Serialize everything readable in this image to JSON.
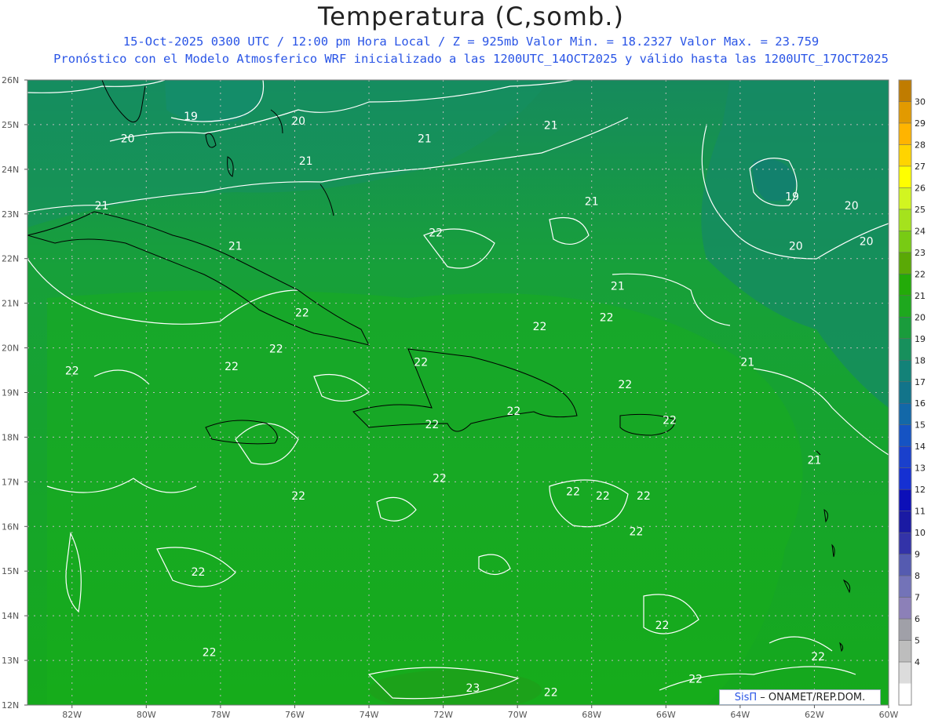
{
  "header": {
    "title": "Temperatura (C,somb.)",
    "subtitle_line1": "15-Oct-2025  0300 UTC / 12:00 pm Hora Local / Z = 925mb    Valor Min. = 18.2327  Valor Max. = 23.759",
    "subtitle_line2": "Pronóstico con el Modelo Atmosferico WRF inicializado a las 1200UTC_14OCT2025 y válido hasta las  1200UTC_17OCT2025"
  },
  "map": {
    "lat_labels": [
      "26N",
      "25N",
      "24N",
      "23N",
      "22N",
      "21N",
      "20N",
      "19N",
      "18N",
      "17N",
      "16N",
      "15N",
      "14N",
      "13N",
      "12N"
    ],
    "lon_labels": [
      "82W",
      "80W",
      "78W",
      "76W",
      "74W",
      "72W",
      "70W",
      "68W",
      "66W",
      "64W",
      "62W",
      "60W"
    ],
    "contour_labels": [
      {
        "text": "19",
        "lon": -78.8,
        "lat": 25.1
      },
      {
        "text": "20",
        "lon": -80.5,
        "lat": 24.6
      },
      {
        "text": "20",
        "lon": -75.9,
        "lat": 25.0
      },
      {
        "text": "21",
        "lon": -75.7,
        "lat": 24.1
      },
      {
        "text": "21",
        "lon": -72.5,
        "lat": 24.6
      },
      {
        "text": "21",
        "lon": -69.1,
        "lat": 24.9
      },
      {
        "text": "21",
        "lon": -81.2,
        "lat": 23.1
      },
      {
        "text": "21",
        "lon": -77.6,
        "lat": 22.2
      },
      {
        "text": "21",
        "lon": -68.0,
        "lat": 23.2
      },
      {
        "text": "19",
        "lon": -62.6,
        "lat": 23.3
      },
      {
        "text": "20",
        "lon": -61.0,
        "lat": 23.1
      },
      {
        "text": "20",
        "lon": -62.5,
        "lat": 22.2
      },
      {
        "text": "20",
        "lon": -60.6,
        "lat": 22.3
      },
      {
        "text": "22",
        "lon": -72.2,
        "lat": 22.5
      },
      {
        "text": "21",
        "lon": -67.3,
        "lat": 21.3
      },
      {
        "text": "22",
        "lon": -75.8,
        "lat": 20.7
      },
      {
        "text": "22",
        "lon": -69.4,
        "lat": 20.4
      },
      {
        "text": "22",
        "lon": -67.6,
        "lat": 20.6
      },
      {
        "text": "22",
        "lon": -76.5,
        "lat": 19.9
      },
      {
        "text": "22",
        "lon": -72.6,
        "lat": 19.6
      },
      {
        "text": "22",
        "lon": -82.0,
        "lat": 19.4
      },
      {
        "text": "22",
        "lon": -77.7,
        "lat": 19.5
      },
      {
        "text": "21",
        "lon": -63.8,
        "lat": 19.6
      },
      {
        "text": "22",
        "lon": -67.1,
        "lat": 19.1
      },
      {
        "text": "22",
        "lon": -72.3,
        "lat": 18.2
      },
      {
        "text": "22",
        "lon": -70.1,
        "lat": 18.5
      },
      {
        "text": "22",
        "lon": -65.9,
        "lat": 18.3
      },
      {
        "text": "21",
        "lon": -62.0,
        "lat": 17.4
      },
      {
        "text": "22",
        "lon": -72.1,
        "lat": 17.0
      },
      {
        "text": "22",
        "lon": -75.9,
        "lat": 16.6
      },
      {
        "text": "22",
        "lon": -68.5,
        "lat": 16.7
      },
      {
        "text": "22",
        "lon": -67.7,
        "lat": 16.6
      },
      {
        "text": "22",
        "lon": -66.6,
        "lat": 16.6
      },
      {
        "text": "22",
        "lon": -66.8,
        "lat": 15.8
      },
      {
        "text": "22",
        "lon": -78.6,
        "lat": 14.9
      },
      {
        "text": "22",
        "lon": -66.1,
        "lat": 13.7
      },
      {
        "text": "22",
        "lon": -78.3,
        "lat": 13.1
      },
      {
        "text": "22",
        "lon": -61.9,
        "lat": 13.0
      },
      {
        "text": "22",
        "lon": -65.2,
        "lat": 12.5
      },
      {
        "text": "23",
        "lon": -71.2,
        "lat": 12.3
      },
      {
        "text": "22",
        "lon": -69.1,
        "lat": 12.2
      }
    ]
  },
  "colorbar": {
    "ticks": [
      "30",
      "29",
      "28",
      "27",
      "26",
      "25",
      "24",
      "23",
      "22",
      "21",
      "20",
      "19",
      "18",
      "17",
      "16",
      "15",
      "14",
      "13",
      "12",
      "11",
      "10",
      "9",
      "8",
      "7",
      "6",
      "5",
      "4"
    ],
    "colors": [
      "#c07c00",
      "#e29a00",
      "#ffb400",
      "#ffd400",
      "#ffff00",
      "#d2f521",
      "#a5e21d",
      "#78cb14",
      "#5aa906",
      "#23ab09",
      "#1ea81e",
      "#1a9c3c",
      "#17905c",
      "#138278",
      "#12748a",
      "#1368a8",
      "#1553c3",
      "#1a40cc",
      "#1530d2",
      "#0c0fb8",
      "#1a1aa3",
      "#3333a8",
      "#555bb0",
      "#7373b8",
      "#8c80b8",
      "#a0a0a8",
      "#bdbdbd",
      "#dcdcdc",
      "#ffffff"
    ]
  },
  "credit": {
    "brand": "SisΠ",
    "text": " – ONAMET/REP.DOM."
  }
}
